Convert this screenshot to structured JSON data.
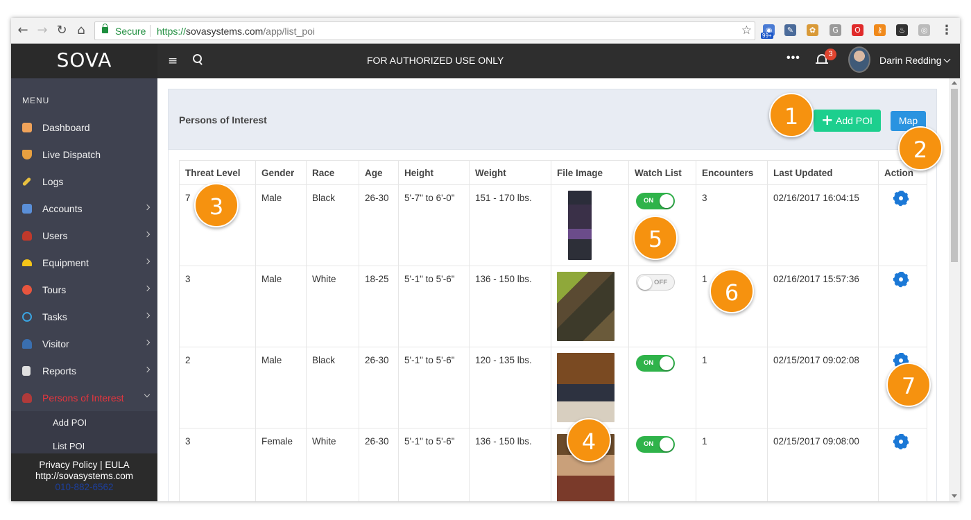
{
  "browser": {
    "secure_label": "Secure",
    "url_scheme": "https://",
    "url_host": "sovasystems.com",
    "url_path": "/app/list_poi",
    "ext_badge": "99+"
  },
  "header": {
    "logo": "SOVA",
    "notice": "FOR AUTHORIZED USE ONLY",
    "more_dots": "•••",
    "notification_count": "3",
    "user_name": "Darin Redding"
  },
  "sidebar": {
    "menu_label": "MENU",
    "items": [
      {
        "label": "Dashboard",
        "icon": "home-icon",
        "color": "#f0a35a"
      },
      {
        "label": "Live Dispatch",
        "icon": "shield-icon",
        "color": "#e8a040"
      },
      {
        "label": "Logs",
        "icon": "pencil-icon",
        "color": "#e8c040"
      },
      {
        "label": "Accounts",
        "icon": "building-icon",
        "color": "#5a8fd8"
      },
      {
        "label": "Users",
        "icon": "user-icon",
        "color": "#c0392b"
      },
      {
        "label": "Equipment",
        "icon": "helmet-icon",
        "color": "#f5c518"
      },
      {
        "label": "Tours",
        "icon": "compass-icon",
        "color": "#e8553e"
      },
      {
        "label": "Tasks",
        "icon": "atom-icon",
        "color": "#3aa3e0"
      },
      {
        "label": "Visitor",
        "icon": "person-icon",
        "color": "#3a6fb0"
      },
      {
        "label": "Reports",
        "icon": "clipboard-icon",
        "color": "#e0e0e0"
      },
      {
        "label": "Persons of Interest",
        "icon": "suspect-icon",
        "color": "#b03a3a"
      }
    ],
    "sub_items": [
      "Add POI",
      "List POI"
    ],
    "footer": {
      "privacy": "Privacy Policy",
      "separator": "|",
      "eula": "EULA",
      "site": "http://sovasystems.com",
      "phone": "010-882-6562"
    }
  },
  "panel": {
    "title": "Persons of Interest",
    "add_button": "Add POI",
    "map_button": "Map"
  },
  "table": {
    "columns": [
      "Threat Level",
      "Gender",
      "Race",
      "Age",
      "Height",
      "Weight",
      "File Image",
      "Watch List",
      "Encounters",
      "Last Updated",
      "Action"
    ],
    "rows": [
      {
        "threat": "7",
        "gender": "Male",
        "race": "Black",
        "age": "26-30",
        "height": "5'-7\" to 6'-0\"",
        "weight": "151 - 170 lbs.",
        "watch": "ON",
        "encounters": "3",
        "updated": "02/16/2017 16:04:15"
      },
      {
        "threat": "3",
        "gender": "Male",
        "race": "White",
        "age": "18-25",
        "height": "5'-1\" to 5'-6\"",
        "weight": "136 - 150 lbs.",
        "watch": "OFF",
        "encounters": "1",
        "updated": "02/16/2017 15:57:36"
      },
      {
        "threat": "2",
        "gender": "Male",
        "race": "Black",
        "age": "26-30",
        "height": "5'-1\" to 5'-6\"",
        "weight": "120 - 135 lbs.",
        "watch": "ON",
        "encounters": "1",
        "updated": "02/15/2017 09:02:08"
      },
      {
        "threat": "3",
        "gender": "Female",
        "race": "White",
        "age": "26-30",
        "height": "5'-1\" to 5'-6\"",
        "weight": "136 - 150 lbs.",
        "watch": "ON",
        "encounters": "1",
        "updated": "02/15/2017 09:08:00"
      }
    ]
  },
  "callouts": [
    "1",
    "2",
    "3",
    "4",
    "5",
    "6",
    "7"
  ],
  "colors": {
    "accent_green": "#1dcf8e",
    "accent_blue": "#2a93e0",
    "callout_orange": "#f6920f",
    "active_red": "#e8353e"
  }
}
